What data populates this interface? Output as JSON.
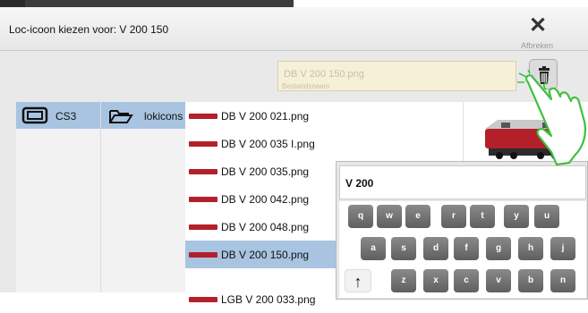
{
  "background": {
    "side_text": [
      "r",
      "t",
      "n"
    ]
  },
  "dialog": {
    "title": "Loc-icoon kiezen voor: V 200 150",
    "close_label": "Afbreken",
    "filename": {
      "value": "DB V 200 150.png",
      "label": "Bestandsnaam"
    }
  },
  "sources": [
    {
      "label": "CS3",
      "icon": "device-icon",
      "selected": true
    }
  ],
  "folders": [
    {
      "label": "lokicons",
      "icon": "folder-icon",
      "selected": true
    }
  ],
  "files": [
    {
      "name": "DB V 200 021.png",
      "selected": false
    },
    {
      "name": "DB V 200 035 I.png",
      "selected": false
    },
    {
      "name": "DB V 200 035.png",
      "selected": false
    },
    {
      "name": "DB V 200 042.png",
      "selected": false
    },
    {
      "name": "DB V 200 048.png",
      "selected": false
    },
    {
      "name": "DB V 200 150.png",
      "selected": true
    },
    {
      "name": "LGB V 200 033.png",
      "selected": false
    }
  ],
  "keyboard": {
    "input_value": "V 200",
    "rows": [
      [
        "q",
        "w",
        "e",
        "r",
        "t",
        "y",
        "u"
      ],
      [
        "a",
        "s",
        "d",
        "f",
        "g",
        "h",
        "j"
      ],
      [
        "↑",
        "z",
        "x",
        "c",
        "v",
        "b",
        "n"
      ]
    ]
  },
  "colors": {
    "selection": "#a8c4e0",
    "field_bg": "#f6f0d8",
    "loco_red": "#b3202a",
    "hand_green": "#3fbf3f"
  }
}
